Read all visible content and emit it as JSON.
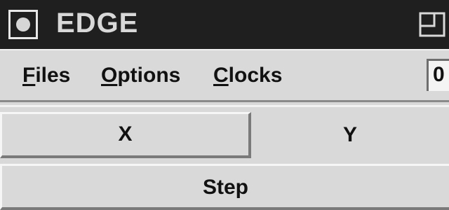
{
  "window": {
    "title": "EDGE",
    "icons": {
      "window_menu": "window-menu-icon",
      "maximize": "maximize-icon"
    }
  },
  "menubar": {
    "items": [
      {
        "mnemonic": "F",
        "rest": "iles"
      },
      {
        "mnemonic": "O",
        "rest": "ptions"
      },
      {
        "mnemonic": "C",
        "rest": "locks"
      }
    ],
    "counter_value": "0"
  },
  "buttons": {
    "x_label": "X",
    "y_label": "Y",
    "step_label": "Step"
  },
  "colors": {
    "titlebar": "#1f1f1f",
    "background": "#d9d9d9",
    "text": "#111111"
  }
}
